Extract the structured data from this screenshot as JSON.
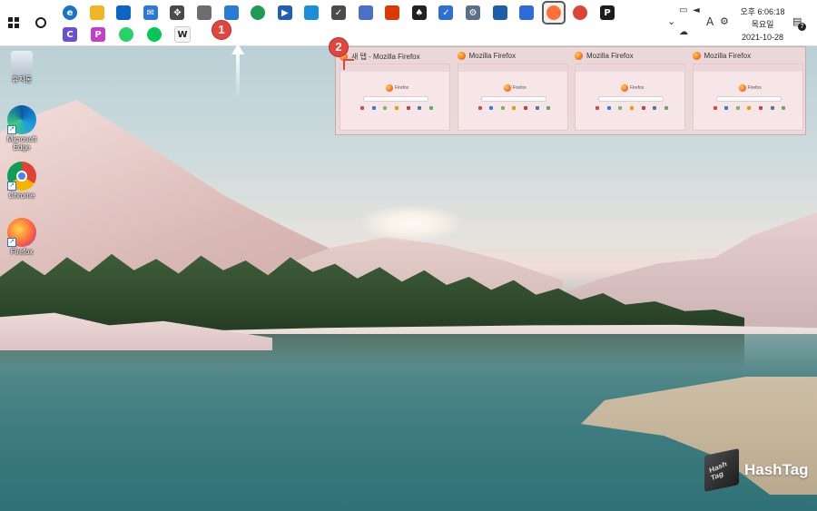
{
  "taskbar": {
    "apps_row1": [
      {
        "name": "edge",
        "color": "#1a73c7",
        "glyph": "e"
      },
      {
        "name": "file-explorer",
        "color": "#f2b523",
        "glyph": ""
      },
      {
        "name": "store",
        "color": "#0a66c2",
        "glyph": ""
      },
      {
        "name": "mail",
        "color": "#2b78d6",
        "glyph": "✉"
      },
      {
        "name": "move-tool",
        "color": "#4a4a4a",
        "glyph": "✥"
      },
      {
        "name": "text-file",
        "color": "#6d6d6d",
        "glyph": ""
      },
      {
        "name": "notepad",
        "color": "#2a7bd3",
        "glyph": ""
      },
      {
        "name": "earth",
        "color": "#1f9b55",
        "glyph": ""
      },
      {
        "name": "media-player",
        "color": "#1f5fb3",
        "glyph": "▶"
      },
      {
        "name": "maps",
        "color": "#1a8fd8",
        "glyph": ""
      },
      {
        "name": "tasks",
        "color": "#4b4b4b",
        "glyph": "✓"
      },
      {
        "name": "calculator",
        "color": "#4c6fc8",
        "glyph": ""
      },
      {
        "name": "office",
        "color": "#d83b01",
        "glyph": ""
      },
      {
        "name": "solitaire",
        "color": "#222222",
        "glyph": "♠"
      },
      {
        "name": "todo",
        "color": "#2e6fd6",
        "glyph": "✓"
      },
      {
        "name": "settings",
        "color": "#5b6e8a",
        "glyph": "⚙"
      },
      {
        "name": "photos",
        "color": "#1a5fa8",
        "glyph": ""
      },
      {
        "name": "calendar",
        "color": "#2c6ed5",
        "glyph": ""
      },
      {
        "name": "firefox",
        "color": "#ff7139",
        "glyph": ""
      },
      {
        "name": "chrome",
        "color": "#db4437",
        "glyph": ""
      },
      {
        "name": "pdf-reader",
        "color": "#1c1c1c",
        "glyph": "P"
      }
    ],
    "apps_row2": [
      {
        "name": "clipchamp",
        "color": "#6c4fd8",
        "glyph": "C"
      },
      {
        "name": "picsart",
        "color": "#c53ec9",
        "glyph": "P"
      },
      {
        "name": "whatsapp",
        "color": "#25d366",
        "glyph": ""
      },
      {
        "name": "line",
        "color": "#06c755",
        "glyph": ""
      },
      {
        "name": "wikipedia",
        "color": "#f4f4f4",
        "glyph": "W"
      }
    ],
    "tray": {
      "time": "오후 6:06:18",
      "day": "목요일",
      "date": "2021-10-28",
      "ime": "A",
      "notification_count": "7"
    }
  },
  "desktop_icons": [
    {
      "label": "휴지통"
    },
    {
      "label": "Microsoft Edge"
    },
    {
      "label": "Chrome"
    },
    {
      "label": "Firefox"
    }
  ],
  "thumbnails": [
    {
      "title": "새 탭 - Mozilla Firefox",
      "brand": "Firefox"
    },
    {
      "title": "Mozilla Firefox",
      "brand": "Firefox"
    },
    {
      "title": "Mozilla Firefox",
      "brand": "Firefox"
    },
    {
      "title": "Mozilla Firefox",
      "brand": "Firefox"
    }
  ],
  "annotations": {
    "step1": "1",
    "step2": "2"
  },
  "watermark": {
    "cube_text": "Hash Tag",
    "text": "HashTag"
  }
}
